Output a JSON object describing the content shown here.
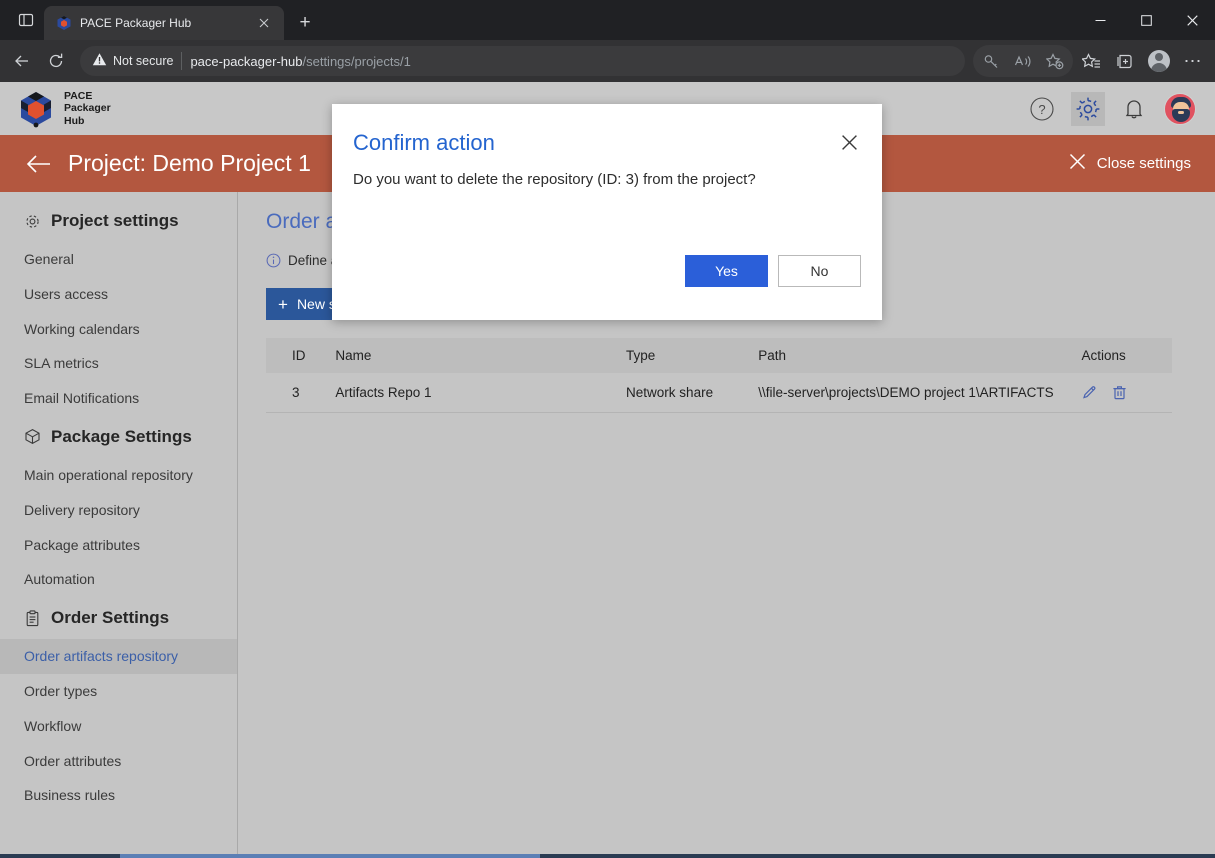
{
  "browser": {
    "tab": {
      "title": "PACE Packager Hub",
      "favicon_icon": "pace-cube-icon",
      "close_icon": "close-icon"
    },
    "new_tab_label": "+",
    "sidebar_toggle_icon": "split-pane-icon",
    "window_controls": {
      "minimize": "—",
      "maximize": "□",
      "close": "✕"
    },
    "nav": {
      "back_icon": "back-arrow-icon",
      "reload_icon": "reload-icon"
    },
    "omnibox": {
      "security_label": "Not secure",
      "security_icon": "warning-triangle-icon",
      "url_host": "pace-packager-hub",
      "url_path": "/settings/projects/1"
    },
    "toolbar_icons": [
      {
        "name": "key-password-icon"
      },
      {
        "name": "read-aloud-icon"
      },
      {
        "name": "add-favorite-icon"
      },
      {
        "name": "favorites-list-icon"
      },
      {
        "name": "collections-icon"
      },
      {
        "name": "profile-avatar-icon"
      },
      {
        "name": "settings-more-icon",
        "glyph": "⋯"
      }
    ]
  },
  "app": {
    "brand": {
      "line1": "PACE",
      "line2": "Packager",
      "line3": "Hub",
      "logo_icon": "pace-cube-logo"
    },
    "header_icons": [
      {
        "name": "help-icon",
        "glyph": "?"
      },
      {
        "name": "gear-settings-icon",
        "active": true
      },
      {
        "name": "notifications-bell-icon"
      },
      {
        "name": "user-avatar"
      }
    ],
    "title_bar": {
      "back_icon": "back-arrow-icon",
      "title": "Project: Demo Project 1",
      "close_settings_label": "Close settings",
      "close_settings_icon": "close-x-icon",
      "background": "#b3573f"
    }
  },
  "sidebar": {
    "sections": [
      {
        "label": "Project settings",
        "icon": "gear-icon",
        "items": [
          {
            "label": "General",
            "selected": false
          },
          {
            "label": "Users access",
            "selected": false
          },
          {
            "label": "Working calendars",
            "selected": false
          },
          {
            "label": "SLA metrics",
            "selected": false
          },
          {
            "label": "Email Notifications",
            "selected": false
          }
        ]
      },
      {
        "label": "Package Settings",
        "icon": "package-cube-icon",
        "items": [
          {
            "label": "Main operational repository",
            "selected": false
          },
          {
            "label": "Delivery repository",
            "selected": false
          },
          {
            "label": "Package attributes",
            "selected": false
          },
          {
            "label": "Automation",
            "selected": false
          }
        ]
      },
      {
        "label": "Order Settings",
        "icon": "clipboard-icon",
        "items": [
          {
            "label": "Order artifacts repository",
            "selected": true
          },
          {
            "label": "Order types",
            "selected": false
          },
          {
            "label": "Workflow",
            "selected": false
          },
          {
            "label": "Order attributes",
            "selected": false
          },
          {
            "label": "Business rules",
            "selected": false
          }
        ]
      }
    ]
  },
  "main": {
    "page_title": "Order artifacts repository",
    "info_icon": "info-circle-icon",
    "info_text": "Define an artifacts repository where the order attachments will be uploaded.",
    "new_server_button": {
      "label": "New server",
      "plus_icon": "plus-icon",
      "caret_icon": "chevron-down-icon"
    },
    "table": {
      "columns": [
        "ID",
        "Name",
        "Type",
        "Path",
        "Actions"
      ],
      "rows": [
        {
          "id": "3",
          "name": "Artifacts Repo 1",
          "type": "Network share",
          "path": "\\\\file-server\\projects\\DEMO project 1\\ARTIFACTS",
          "actions": [
            {
              "name": "edit-pencil-icon"
            },
            {
              "name": "delete-trash-icon"
            }
          ]
        }
      ]
    }
  },
  "modal": {
    "title": "Confirm action",
    "close_icon": "close-x-icon",
    "message": "Do you want to delete the repository (ID: 3) from the project?",
    "confirm_label": "Yes",
    "cancel_label": "No",
    "confirm_color": "#2b5fd9"
  }
}
